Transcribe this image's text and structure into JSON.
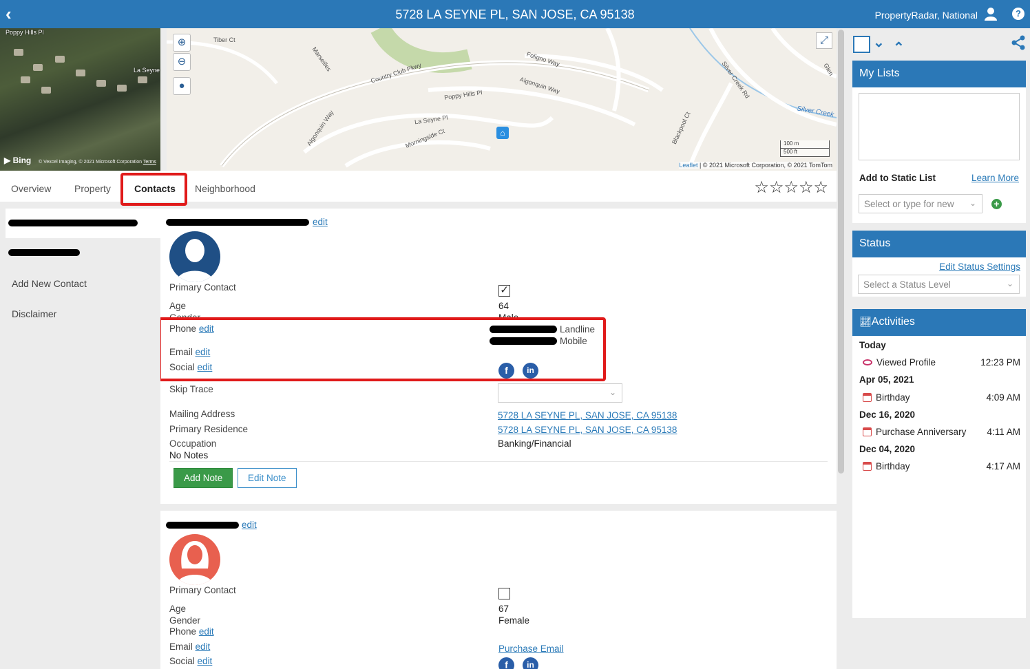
{
  "header": {
    "title": "5728 LA SEYNE PL, SAN JOSE, CA 95138",
    "account": "PropertyRadar, National",
    "help": "?"
  },
  "aerial": {
    "labels": [
      "Poppy Hills Pl",
      "La Seyne"
    ],
    "bing": "Bing",
    "copyright": "© Vexcel Imaging, © 2021 Microsoft Corporation",
    "terms": "Terms"
  },
  "map": {
    "streets": [
      "Tiber Ct",
      "Marseilles",
      "Country Club Pkwy",
      "Poppy Hills Pl",
      "La Seyne Pl",
      "Morningside Ct",
      "Algonquin Way",
      "Foligno Way",
      "Algonquin Way",
      "Blackpool Ct",
      "Silver Creek Rd",
      "Silver Creek",
      "Glen"
    ],
    "scale_m": "100 m",
    "scale_ft": "500 ft",
    "attribution_link": "Leaflet",
    "attribution": "| © 2021 Microsoft Corporation, © 2021 TomTom"
  },
  "tabs": [
    "Overview",
    "Property",
    "Contacts",
    "Neighborhood"
  ],
  "rating": "☆☆☆☆☆",
  "leftnav": {
    "add_contact": "Add New Contact",
    "disclaimer": "Disclaimer"
  },
  "contact1": {
    "edit": "edit",
    "labels": {
      "primary": "Primary Contact",
      "age": "Age",
      "gender": "Gender",
      "phone": "Phone",
      "email": "Email",
      "social": "Social",
      "skip": "Skip Trace",
      "mailing": "Mailing Address",
      "residence": "Primary Residence",
      "occupation": "Occupation",
      "notes": "No Notes"
    },
    "age": "64",
    "gender": "Male",
    "phone_types": [
      "Landline",
      "Mobile"
    ],
    "mailing": "5728 LA SEYNE PL, SAN JOSE, CA 95138",
    "residence": "5728 LA SEYNE PL, SAN JOSE, CA 95138",
    "occupation": "Banking/Financial",
    "add_note": "Add Note",
    "edit_note": "Edit Note"
  },
  "contact2": {
    "edit": "edit",
    "labels": {
      "primary": "Primary Contact",
      "age": "Age",
      "gender": "Gender",
      "phone": "Phone",
      "email": "Email",
      "social": "Social"
    },
    "age": "67",
    "gender": "Female",
    "purchase_email": "Purchase Email"
  },
  "sidebar": {
    "my_lists": "My Lists",
    "add_static": "Add to Static List",
    "learn_more": "Learn More",
    "list_placeholder": "Select or type for new",
    "status": "Status",
    "edit_status": "Edit Status Settings",
    "status_placeholder": "Select a Status Level",
    "activities": "Activities",
    "groups": [
      {
        "date": "Today",
        "label": "Viewed Profile",
        "time": "12:23 PM"
      },
      {
        "date": "Apr 05, 2021",
        "label": "Birthday",
        "time": "4:09 AM"
      },
      {
        "date": "Dec 16, 2020",
        "label": "Purchase Anniversary",
        "time": "4:11 AM"
      },
      {
        "date": "Dec 04, 2020",
        "label": "Birthday",
        "time": "4:17 AM"
      }
    ]
  },
  "colors": {
    "brand": "#2b78b7",
    "highlight": "#e01a1a",
    "green": "#3a9a48"
  }
}
